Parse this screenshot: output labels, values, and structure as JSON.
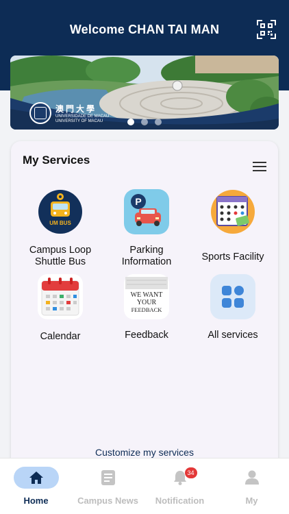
{
  "header": {
    "welcome": "Welcome CHAN TAI MAN"
  },
  "banner": {
    "logo_cn": "澳門大學",
    "logo_pt": "UNIVERSIDADE DE MACAU",
    "logo_en": "UNIVERSITY OF MACAU",
    "slide_count": 3,
    "active_slide": 1
  },
  "services": {
    "title": "My Services",
    "items": [
      {
        "label": "Campus Loop\nShuttle Bus",
        "icon": "shuttle-bus-icon",
        "icon_text": "UM BUS"
      },
      {
        "label": "Parking\nInformation",
        "icon": "parking-icon",
        "icon_text": "P"
      },
      {
        "label": "Sports Facility",
        "icon": "sports-facility-icon"
      },
      {
        "label": "Calendar",
        "icon": "calendar-icon"
      },
      {
        "label": "Feedback",
        "icon": "feedback-icon",
        "icon_text": [
          "WE WANT",
          "YOUR",
          "FEEDBACK"
        ]
      },
      {
        "label": "All services",
        "icon": "all-services-icon"
      }
    ],
    "customize": "Customize my services"
  },
  "tabbar": {
    "tabs": [
      {
        "label": "Home",
        "icon": "home-icon",
        "active": true
      },
      {
        "label": "Campus News",
        "icon": "news-icon",
        "active": false
      },
      {
        "label": "Notification",
        "icon": "bell-icon",
        "active": false,
        "badge": "34"
      },
      {
        "label": "My",
        "icon": "person-icon",
        "active": false
      }
    ]
  },
  "colors": {
    "header_bg": "#0d2c55",
    "active_tab_pill": "#b9d5f7",
    "badge": "#e33838"
  }
}
